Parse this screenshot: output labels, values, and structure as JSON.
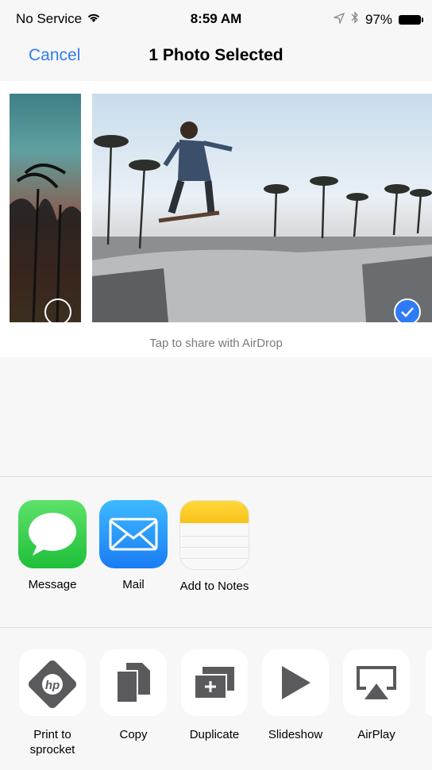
{
  "status_bar": {
    "carrier": "No Service",
    "time": "8:59 AM",
    "battery": "97%"
  },
  "nav": {
    "cancel": "Cancel",
    "title": "1 Photo Selected"
  },
  "airdrop_hint": "Tap to share with AirDrop",
  "share_apps": [
    {
      "label": "Message",
      "icon": "message-icon"
    },
    {
      "label": "Mail",
      "icon": "mail-icon"
    },
    {
      "label": "Add to Notes",
      "icon": "notes-icon"
    }
  ],
  "actions": [
    {
      "label": "Print to sprocket",
      "icon": "hp-sprocket-icon"
    },
    {
      "label": "Copy",
      "icon": "copy-icon"
    },
    {
      "label": "Duplicate",
      "icon": "duplicate-icon"
    },
    {
      "label": "Slideshow",
      "icon": "play-icon"
    },
    {
      "label": "AirPlay",
      "icon": "airplay-icon"
    }
  ],
  "colors": {
    "accent": "#2f7bf5",
    "background": "#f7f7f7",
    "message_green": "#1fbf3a",
    "mail_blue": "#1a7cf4",
    "notes_yellow": "#f7c21a"
  }
}
